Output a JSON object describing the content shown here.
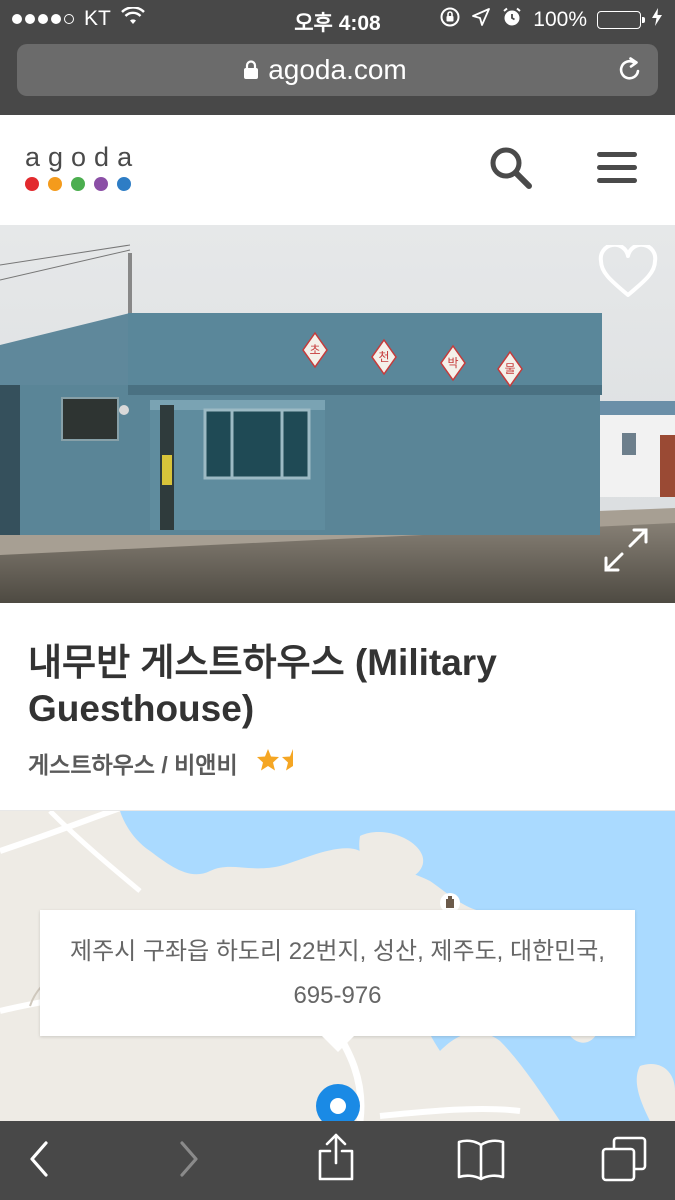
{
  "status_bar": {
    "carrier": "KT",
    "time": "오후 4:08",
    "battery_percent": "100%",
    "battery_level": 1.0,
    "battery_color": "#4cd964"
  },
  "browser": {
    "url": "agoda.com",
    "icons": [
      "lock-icon",
      "reload-icon",
      "back-icon",
      "forward-icon",
      "share-icon",
      "bookmarks-icon",
      "tabs-icon"
    ]
  },
  "header": {
    "logo_text": "agoda",
    "logo_dot_colors": [
      "#e22a2e",
      "#f49b1c",
      "#4bae4f",
      "#8b4fa6",
      "#2e7dc5"
    ],
    "icons": [
      "search-icon",
      "menu-icon"
    ]
  },
  "hero": {
    "sign_text": [
      "초",
      "천",
      "박",
      "물"
    ],
    "icons": [
      "heart-icon",
      "expand-icon"
    ]
  },
  "property": {
    "title": "내무반 게스트하우스 (Military Guesthouse)",
    "category": "게스트하우스 / 비앤비",
    "star_rating": 1.5,
    "star_color": "#f5a623"
  },
  "map": {
    "address": "제주시 구좌읍 하도리 22번지, 성산, 제주도, 대한민국, 695-976",
    "water_color": "#aadaff",
    "land_color": "#eeebe5",
    "pin_color": "#1a8ae5"
  }
}
